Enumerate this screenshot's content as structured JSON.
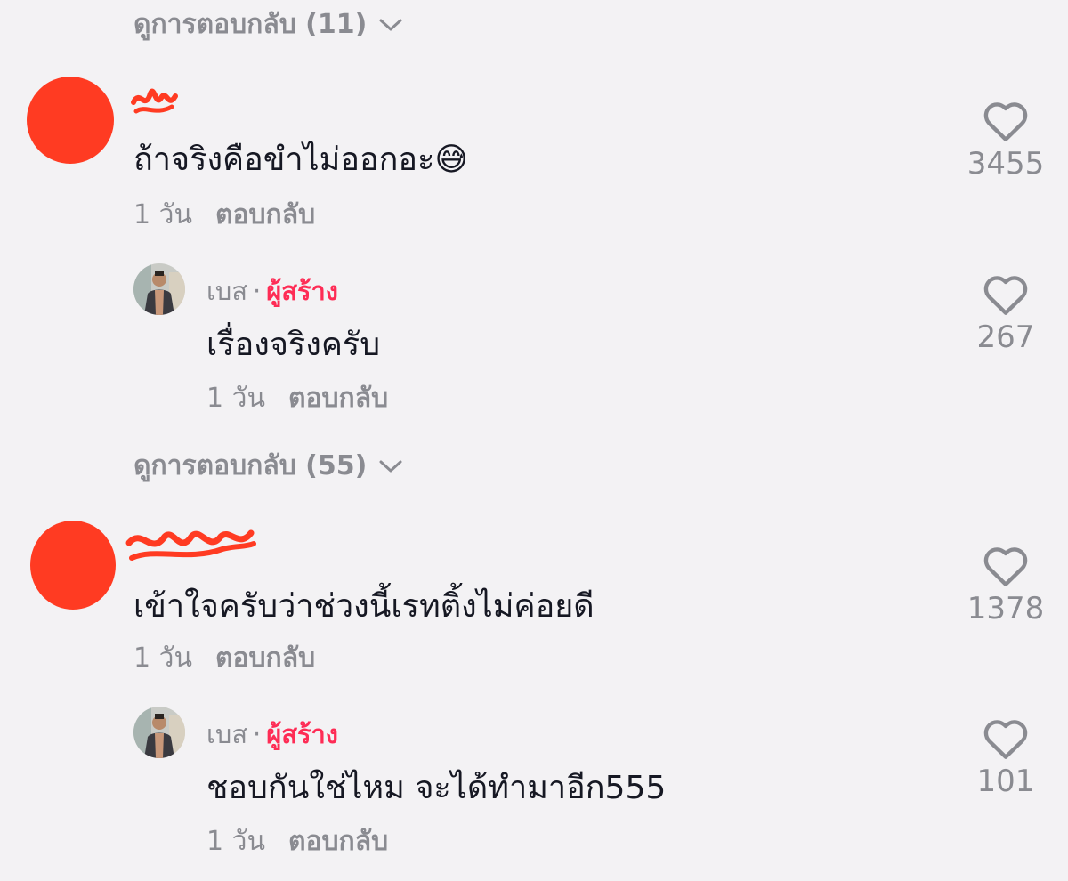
{
  "threads": [
    {
      "view_replies": "ดูการตอบกลับ (11)",
      "comment_text": "ถ้าจริงคือขำไม่ออกอะ😅",
      "time": "1 วัน",
      "reply_label": "ตอบกลับ",
      "likes": "3455",
      "creator_reply": {
        "username": "เบส",
        "separator": "·",
        "creator_label": "ผู้สร้าง",
        "text": "เรื่องจริงครับ",
        "time": "1 วัน",
        "reply_label": "ตอบกลับ",
        "likes": "267"
      }
    },
    {
      "view_replies": "ดูการตอบกลับ (55)",
      "comment_text": "เข้าใจครับว่าช่วงนี้เรทติ้งไม่ค่อยดี",
      "time": "1 วัน",
      "reply_label": "ตอบกลับ",
      "likes": "1378",
      "creator_reply": {
        "username": "เบส",
        "separator": "·",
        "creator_label": "ผู้สร้าง",
        "text": "ชอบกันใช่ไหม จะได้ทำมาอีก555",
        "time": "1 วัน",
        "reply_label": "ตอบกลับ",
        "likes": "101"
      }
    }
  ],
  "colors": {
    "background": "#f3f2f4",
    "text": "#161823",
    "muted": "#8a8b91",
    "creator": "#fe2c55",
    "redaction": "#ff3b22"
  },
  "icons": {
    "like": "heart-outline-icon",
    "expand": "chevron-down-icon"
  }
}
